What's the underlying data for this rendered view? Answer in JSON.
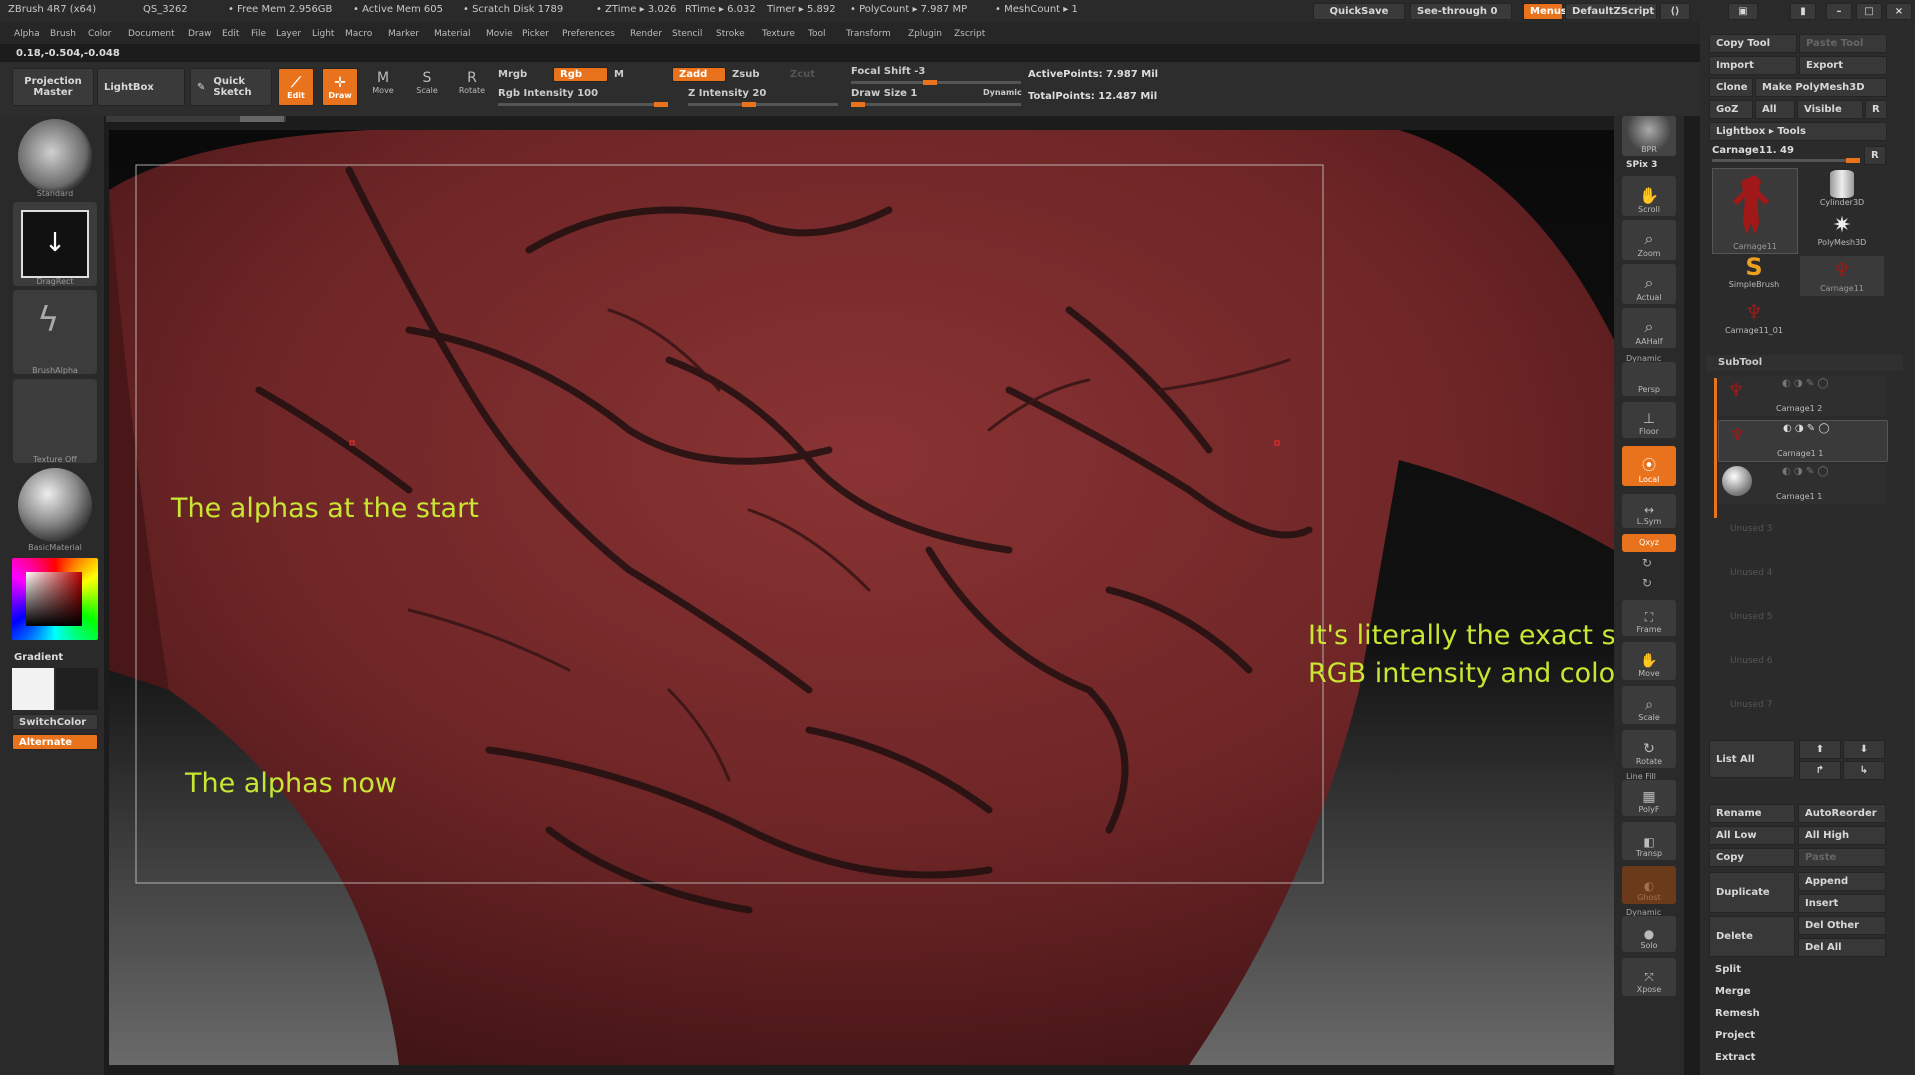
{
  "titlebar": {
    "app": "ZBrush 4R7 (x64)",
    "qs": "QS_3262",
    "free_mem": "• Free Mem 2.956GB",
    "active_mem": "• Active Mem 605",
    "scratch": "• Scratch Disk 1789",
    "ztime": "• ZTime ▸ 3.026",
    "rtime": "RTime ▸ 6.032",
    "timer": "Timer ▸ 5.892",
    "polycount": "• PolyCount ▸ 7.987 MP",
    "meshcount": "• MeshCount ▸ 1",
    "quicksave": "QuickSave",
    "see_through": "See-through   0",
    "menus": "Menus",
    "script": "DefaultZScript"
  },
  "menubar": {
    "items": [
      "Alpha",
      "Brush",
      "Color",
      "Document",
      "Draw",
      "Edit",
      "File",
      "Layer",
      "Light",
      "Macro",
      "Marker",
      "Material",
      "Movie",
      "Picker",
      "Preferences",
      "Render",
      "Stencil",
      "Stroke",
      "Texture",
      "Tool",
      "Transform",
      "Zplugin",
      "Zscript"
    ],
    "coords": "0.18,-0.504,-0.048"
  },
  "toolbar": {
    "projection_master": "Projection Master",
    "lightbox": "LightBox",
    "quick_sketch": "Quick Sketch",
    "edit": "Edit",
    "draw": "Draw",
    "move": "Move",
    "scale": "Scale",
    "rotate": "Rotate",
    "mrgb": "Mrgb",
    "rgb": "Rgb",
    "m": "M",
    "rgb_intensity": "Rgb Intensity 100",
    "zadd": "Zadd",
    "zsub": "Zsub",
    "zcut": "Zcut",
    "z_intensity": "Z Intensity 20",
    "focal_shift": "Focal Shift -3",
    "draw_size": "Draw Size 1",
    "dynamic": "Dynamic",
    "active_points": "ActivePoints: 7.987 Mil",
    "total_points": "TotalPoints: 12.487 Mil"
  },
  "leftshelf": {
    "standard": "Standard",
    "dragrect": "DragRect",
    "brushalpha": "BrushAlpha",
    "texture_off": "Texture Off",
    "basicmaterial": "BasicMaterial",
    "gradient": "Gradient",
    "switchcolor": "SwitchColor",
    "alternate": "Alternate"
  },
  "annotations": {
    "start": "The alphas at the start",
    "now": "The alphas now",
    "same_line1": "It's literally the exact same",
    "same_line2": "RGB intensity and colour"
  },
  "rightshelf": {
    "bpr": "BPR",
    "spix": "SPix 3",
    "scroll": "Scroll",
    "zoom": "Zoom",
    "actual": "Actual",
    "aahalf": "AAHalf",
    "dynamic": "Dynamic",
    "persp": "Persp",
    "floor": "Floor",
    "local": "Local",
    "lsym": "L.Sym",
    "xyz": "Qxyz",
    "frame": "Frame",
    "move": "Move",
    "scale": "Scale",
    "rotate": "Rotate",
    "linefill": "Line Fill",
    "polyf": "PolyF",
    "transp": "Transp",
    "ghost": "Ghost",
    "solo": "Solo",
    "xpose": "Xpose"
  },
  "tray": {
    "copy_tool": "Copy Tool",
    "paste_tool": "Paste Tool",
    "import": "Import",
    "export": "Export",
    "clone": "Clone",
    "make_polymesh": "Make PolyMesh3D",
    "goz": "GoZ",
    "all": "All",
    "visible": "Visible",
    "r": "R",
    "lightbox_tools": "Lightbox ▸ Tools",
    "current_tool": "Carnage11. 49",
    "tool_thumbs": [
      "Carnage11",
      "Cylinder3D",
      "PolyMesh3D",
      "SimpleBrush",
      "Carnage11",
      "Carnage11_01"
    ],
    "subtool_title": "SubTool",
    "subtools": [
      "Carnage1 2",
      "Carnage1 1",
      "Carnage1 1"
    ],
    "unused": [
      "Unused 3",
      "Unused 4",
      "Unused 5",
      "Unused 6",
      "Unused 7"
    ],
    "list_all": "List All",
    "rename": "Rename",
    "autoreorder": "AutoReorder",
    "all_low": "All Low",
    "all_high": "All High",
    "copy": "Copy",
    "paste": "Paste",
    "duplicate": "Duplicate",
    "append": "Append",
    "insert": "Insert",
    "delete": "Delete",
    "del_other": "Del Other",
    "del_all": "Del All",
    "split": "Split",
    "merge": "Merge",
    "remesh": "Remesh",
    "project": "Project",
    "extract": "Extract"
  },
  "colors": {
    "accent": "#e8731c",
    "annotation": "#c8e632",
    "skin": "#7a2a2a"
  }
}
